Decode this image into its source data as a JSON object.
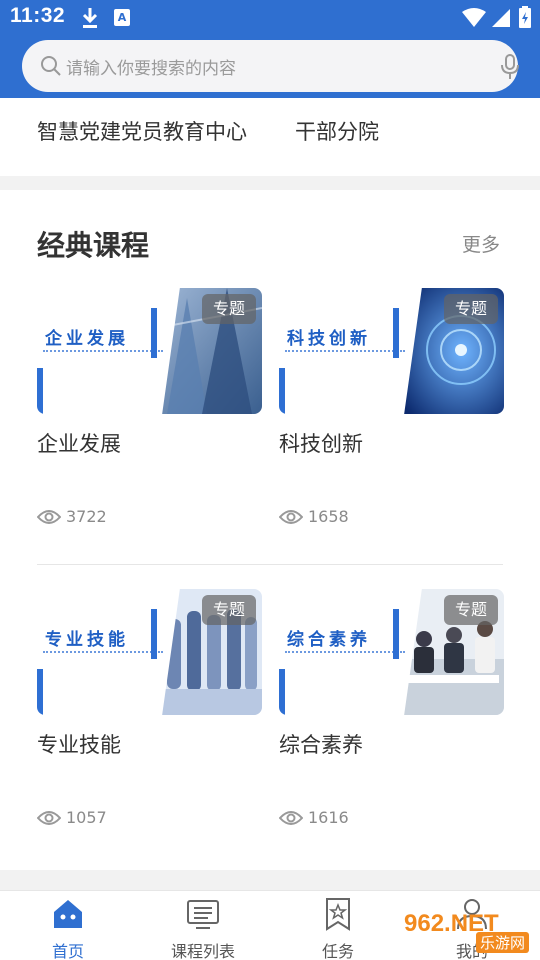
{
  "status": {
    "time": "11:32",
    "notif_icon_text": "A"
  },
  "search": {
    "placeholder": "请输入你要搜索的内容"
  },
  "links": [
    "智慧党建党员教育中心",
    "干部分院"
  ],
  "section": {
    "title": "经典课程",
    "more": "更多",
    "badge": "专题",
    "courses": [
      {
        "title": "企业发展",
        "thumb_text": "企业发展",
        "views": "3722"
      },
      {
        "title": "科技创新",
        "thumb_text": "科技创新",
        "views": "1658"
      },
      {
        "title": "专业技能",
        "thumb_text": "专业技能",
        "views": "1057"
      },
      {
        "title": "综合素养",
        "thumb_text": "综合素养",
        "views": "1616"
      }
    ]
  },
  "tabs": [
    {
      "label": "首页",
      "icon": "home-icon",
      "active": true
    },
    {
      "label": "课程列表",
      "icon": "course-list-icon",
      "active": false
    },
    {
      "label": "任务",
      "icon": "task-bookmark-icon",
      "active": false
    },
    {
      "label": "我的",
      "icon": "user-icon",
      "active": false
    }
  ],
  "watermark": {
    "main": "962.NET",
    "sub": "乐游网"
  },
  "colors": {
    "brand": "#2f6fd0",
    "accent": "#1f5fc4",
    "watermark": "#f28a1e"
  }
}
